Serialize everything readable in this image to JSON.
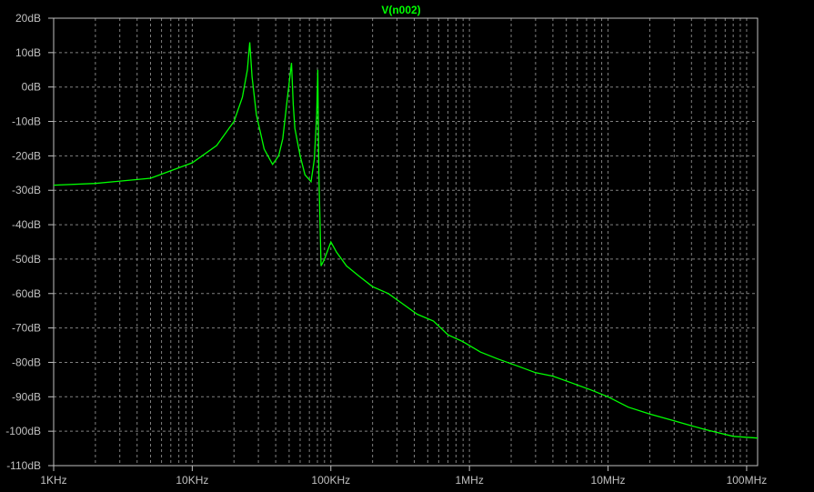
{
  "chart_data": {
    "type": "line",
    "title": "V(n002)",
    "x_scale": "log",
    "xlim": [
      1000,
      120000000
    ],
    "ylim": [
      -110,
      20
    ],
    "grid": true,
    "x_ticks": [
      {
        "label": "1KHz",
        "value": 1000
      },
      {
        "label": "10KHz",
        "value": 10000
      },
      {
        "label": "100KHz",
        "value": 100000
      },
      {
        "label": "1MHz",
        "value": 1000000
      },
      {
        "label": "10MHz",
        "value": 10000000
      },
      {
        "label": "100MHz",
        "value": 100000000
      }
    ],
    "y_ticks": [
      {
        "label": "20dB",
        "value": 20
      },
      {
        "label": "10dB",
        "value": 10
      },
      {
        "label": "0dB",
        "value": 0
      },
      {
        "label": "-10dB",
        "value": -10
      },
      {
        "label": "-20dB",
        "value": -20
      },
      {
        "label": "-30dB",
        "value": -30
      },
      {
        "label": "-40dB",
        "value": -40
      },
      {
        "label": "-50dB",
        "value": -50
      },
      {
        "label": "-60dB",
        "value": -60
      },
      {
        "label": "-70dB",
        "value": -70
      },
      {
        "label": "-80dB",
        "value": -80
      },
      {
        "label": "-90dB",
        "value": -90
      },
      {
        "label": "-100dB",
        "value": -100
      },
      {
        "label": "-110dB",
        "value": -110
      }
    ],
    "series": [
      {
        "color": "#00ff00",
        "x": [
          1000,
          2000,
          5000,
          10000,
          15000,
          20000,
          23000,
          25000,
          26000,
          27000,
          29000,
          33000,
          38000,
          42000,
          45000,
          48000,
          52000,
          53500,
          55000,
          60000,
          65000,
          72000,
          76000,
          79000,
          80500,
          82000,
          85000,
          90000,
          100000,
          110000,
          130000,
          160000,
          200000,
          260000,
          330000,
          420000,
          550000,
          700000,
          900000,
          1200000,
          1600000,
          2200000,
          3000000,
          4000000,
          5500000,
          7500000,
          10000000,
          14000000,
          20000000,
          30000000,
          50000000,
          80000000,
          120000000
        ],
        "y": [
          -28.5,
          -28,
          -26.5,
          -22,
          -17,
          -10,
          -3,
          5,
          13,
          3,
          -8,
          -18,
          -22.5,
          -20,
          -15,
          -5,
          7,
          -5,
          -12,
          -20,
          -25.5,
          -27.5,
          -21,
          -8,
          5,
          -25,
          -52,
          -50,
          -45,
          -48,
          -52,
          -55,
          -58,
          -60,
          -63,
          -66,
          -68,
          -72,
          -74,
          -77,
          -79,
          -81,
          -83,
          -84,
          -86,
          -88,
          -90,
          -93,
          -95,
          -97,
          -99.5,
          -101.5,
          -102
        ]
      }
    ]
  }
}
